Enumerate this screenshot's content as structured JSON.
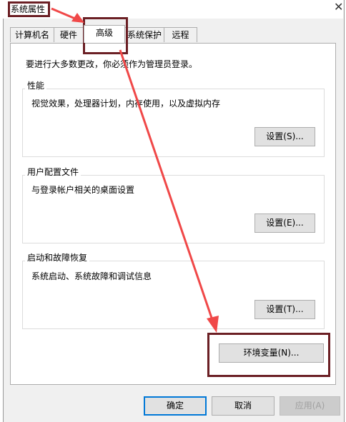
{
  "window": {
    "title": "系统属性"
  },
  "tabs": [
    {
      "label": "计算机名"
    },
    {
      "label": "硬件"
    },
    {
      "label": "高级"
    },
    {
      "label": "系统保护"
    },
    {
      "label": "远程"
    }
  ],
  "notice": "要进行大多数更改，你必须作为管理员登录。",
  "groups": {
    "performance": {
      "label": "性能",
      "desc": "视觉效果，处理器计划，内存使用，以及虚拟内存",
      "button": "设置(S)..."
    },
    "profiles": {
      "label": "用户配置文件",
      "desc": "与登录帐户相关的桌面设置",
      "button": "设置(E)..."
    },
    "startup": {
      "label": "启动和故障恢复",
      "desc": "系统启动、系统故障和调试信息",
      "button": "设置(T)..."
    }
  },
  "env_button": "环境变量(N)...",
  "footer": {
    "ok": "确定",
    "cancel": "取消",
    "apply": "应用(A)"
  },
  "annotation_color": "#6b1f24",
  "arrow_color": "#f04848"
}
